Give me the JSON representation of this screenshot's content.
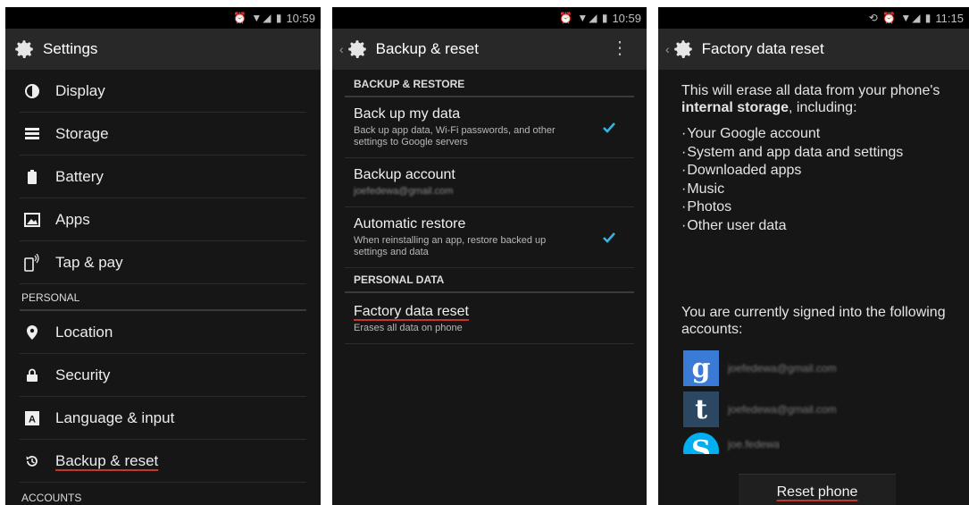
{
  "panel1": {
    "status_time": "10:59",
    "title": "Settings",
    "items_top": [
      {
        "label": "Display",
        "icon": "display-icon"
      },
      {
        "label": "Storage",
        "icon": "storage-icon"
      },
      {
        "label": "Battery",
        "icon": "battery-icon"
      },
      {
        "label": "Apps",
        "icon": "apps-icon"
      },
      {
        "label": "Tap & pay",
        "icon": "tap-pay-icon"
      }
    ],
    "section_personal": "PERSONAL",
    "items_personal": [
      {
        "label": "Location",
        "icon": "location-icon"
      },
      {
        "label": "Security",
        "icon": "lock-icon"
      },
      {
        "label": "Language & input",
        "icon": "keyboard-icon"
      },
      {
        "label": "Backup & reset",
        "icon": "backup-icon"
      }
    ],
    "section_accounts": "ACCOUNTS"
  },
  "panel2": {
    "status_time": "10:59",
    "title": "Backup & reset",
    "section_backup": "BACKUP & RESTORE",
    "backup_data": {
      "title": "Back up my data",
      "subtitle": "Back up app data, Wi-Fi passwords, and other settings to Google servers",
      "checked": true
    },
    "backup_account": {
      "title": "Backup account",
      "subtitle": "joefedewa@gmail.com"
    },
    "auto_restore": {
      "title": "Automatic restore",
      "subtitle": "When reinstalling an app, restore backed up settings and data",
      "checked": true
    },
    "section_personal": "PERSONAL DATA",
    "factory_reset": {
      "title": "Factory data reset",
      "subtitle": "Erases all data on phone"
    }
  },
  "panel3": {
    "status_time": "11:15",
    "title": "Factory data reset",
    "intro_1": "This will erase all data from your phone's ",
    "intro_bold": "internal storage",
    "intro_2": ", including:",
    "erase_items": [
      "Your Google account",
      "System and app data and settings",
      "Downloaded apps",
      "Music",
      "Photos",
      "Other user data"
    ],
    "signed_in_text": "You are currently signed into the following accounts:",
    "accounts": [
      {
        "service": "google",
        "glyph": "g",
        "color": "#3a7bd5",
        "email": "joefedewa@gmail.com"
      },
      {
        "service": "tumblr",
        "glyph": "t",
        "color": "#2c4762",
        "email": "joefedewa@gmail.com"
      },
      {
        "service": "skype",
        "glyph": "S",
        "color": "#00aff0",
        "email": "joe.fedewa"
      }
    ],
    "reset_button": "Reset phone"
  },
  "colors": {
    "check": "#33b5e5",
    "underline": "#c0392b"
  }
}
